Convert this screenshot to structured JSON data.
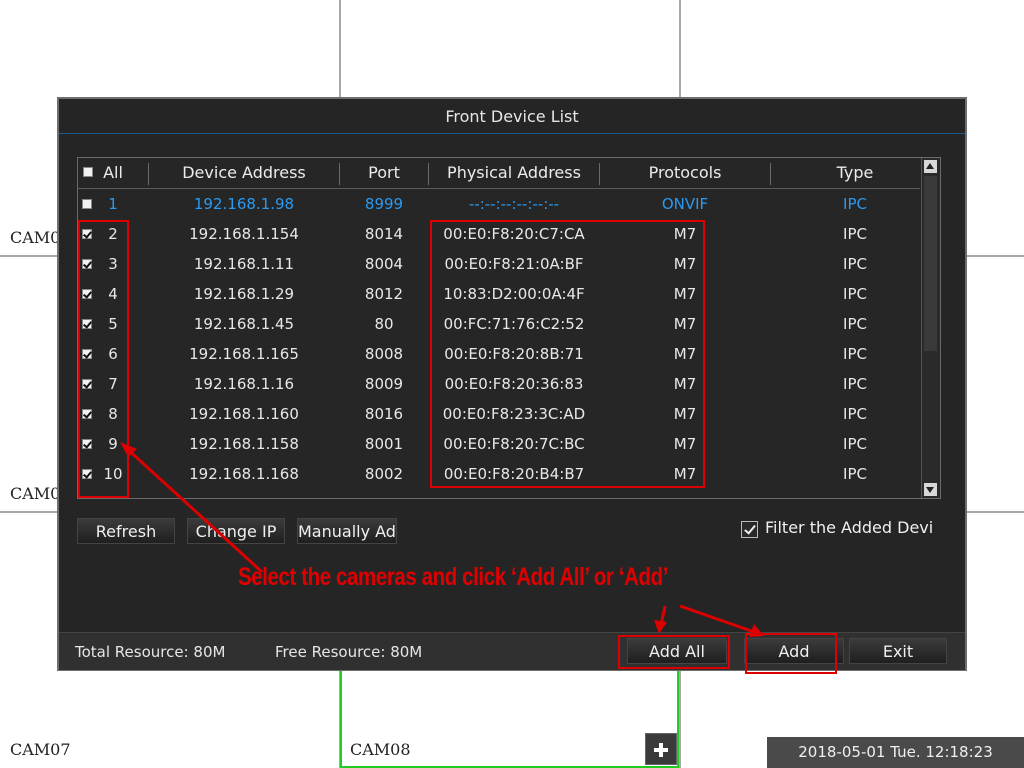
{
  "cameras": [
    "CAM0",
    "CAM0",
    "CAM07",
    "CAM08"
  ],
  "datetime": "2018-05-01 Tue. 12:18:23",
  "dialog": {
    "title": "Front Device List",
    "columns": [
      "All",
      "Device Address",
      "Port",
      "Physical Address",
      "Protocols",
      "Type"
    ],
    "rows": [
      {
        "num": "1",
        "address": "192.168.1.98",
        "port": "8999",
        "mac": "--:--:--:--:--:--",
        "protocol": "ONVIF",
        "type": "IPC",
        "checked": false,
        "highlight": true
      },
      {
        "num": "2",
        "address": "192.168.1.154",
        "port": "8014",
        "mac": "00:E0:F8:20:C7:CA",
        "protocol": "M7",
        "type": "IPC",
        "checked": true
      },
      {
        "num": "3",
        "address": "192.168.1.11",
        "port": "8004",
        "mac": "00:E0:F8:21:0A:BF",
        "protocol": "M7",
        "type": "IPC",
        "checked": true
      },
      {
        "num": "4",
        "address": "192.168.1.29",
        "port": "8012",
        "mac": "10:83:D2:00:0A:4F",
        "protocol": "M7",
        "type": "IPC",
        "checked": true
      },
      {
        "num": "5",
        "address": "192.168.1.45",
        "port": "80",
        "mac": "00:FC:71:76:C2:52",
        "protocol": "M7",
        "type": "IPC",
        "checked": true
      },
      {
        "num": "6",
        "address": "192.168.1.165",
        "port": "8008",
        "mac": "00:E0:F8:20:8B:71",
        "protocol": "M7",
        "type": "IPC",
        "checked": true
      },
      {
        "num": "7",
        "address": "192.168.1.16",
        "port": "8009",
        "mac": "00:E0:F8:20:36:83",
        "protocol": "M7",
        "type": "IPC",
        "checked": true
      },
      {
        "num": "8",
        "address": "192.168.1.160",
        "port": "8016",
        "mac": "00:E0:F8:23:3C:AD",
        "protocol": "M7",
        "type": "IPC",
        "checked": true
      },
      {
        "num": "9",
        "address": "192.168.1.158",
        "port": "8001",
        "mac": "00:E0:F8:20:7C:BC",
        "protocol": "M7",
        "type": "IPC",
        "checked": true
      },
      {
        "num": "10",
        "address": "192.168.1.168",
        "port": "8002",
        "mac": "00:E0:F8:20:B4:B7",
        "protocol": "M7",
        "type": "IPC",
        "checked": true
      }
    ],
    "buttons": {
      "refresh": "Refresh",
      "change_ip": "Change IP",
      "manual_add": "Manually Add"
    },
    "filter_label": "Filter the Added Devi",
    "filter_checked": true,
    "total_resource": "Total Resource: 80M",
    "free_resource": "Free Resource: 80M",
    "add_all": "Add All",
    "add": "Add",
    "exit": "Exit"
  },
  "annotation": {
    "text": "Select the cameras and click ‘Add All’ or ‘Add’",
    "color": "#dd0000"
  },
  "colors": {
    "highlight": "#2a9af0",
    "panel": "#252525",
    "title_rule": "#1e5a8a",
    "selected_tile": "#22cc22"
  }
}
